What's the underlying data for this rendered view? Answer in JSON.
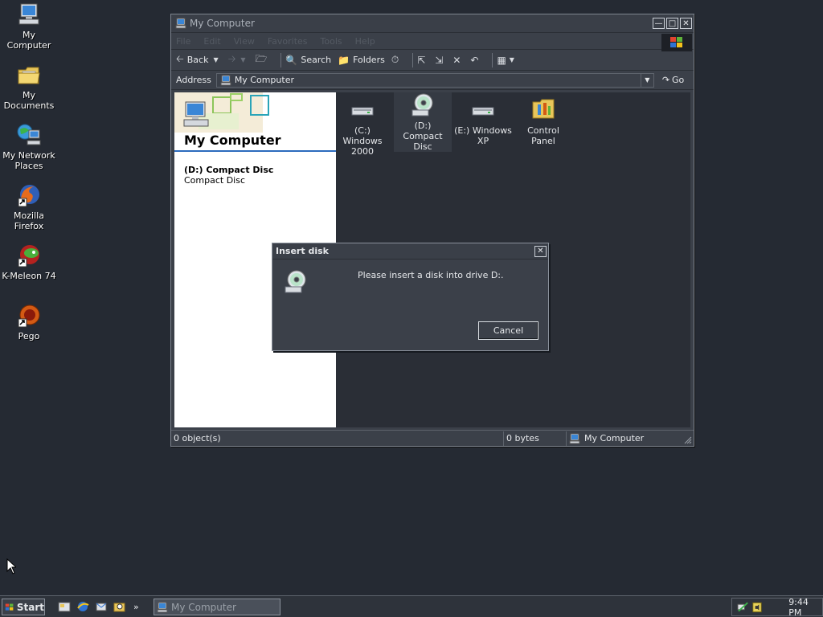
{
  "desktop": {
    "icons": [
      {
        "label": "My Computer",
        "icon": "my-computer-icon"
      },
      {
        "label": "My Documents",
        "icon": "folder-icon"
      },
      {
        "label": "My Network Places",
        "icon": "network-icon"
      },
      {
        "label": "Mozilla Firefox",
        "icon": "firefox-icon"
      },
      {
        "label": "K-Meleon 74",
        "icon": "k-meleon-icon"
      },
      {
        "label": "Pego",
        "icon": "pego-icon"
      }
    ]
  },
  "window": {
    "title": "My Computer",
    "menu": [
      "File",
      "Edit",
      "View",
      "Favorites",
      "Tools",
      "Help"
    ],
    "toolbar": {
      "back": "Back",
      "search": "Search",
      "folders": "Folders"
    },
    "address": {
      "label": "Address",
      "value": "My Computer",
      "go": "Go"
    },
    "left_pane": {
      "title": "My Computer",
      "drive_name": "(D:) Compact Disc",
      "drive_type": "Compact Disc"
    },
    "items": [
      {
        "label": "(C:) Windows 2000",
        "icon": "hard-drive-icon"
      },
      {
        "label": "(D:) Compact Disc",
        "icon": "cd-drive-icon"
      },
      {
        "label": "(E:) Windows XP",
        "icon": "hard-drive-icon"
      },
      {
        "label": "Control Panel",
        "icon": "control-panel-icon"
      }
    ],
    "status": {
      "objects": "0 object(s)",
      "size": "0 bytes",
      "location": "My Computer"
    }
  },
  "dialog": {
    "title": "Insert disk",
    "message": "Please insert a disk into drive D:.",
    "cancel": "Cancel"
  },
  "taskbar": {
    "start": "Start",
    "task": "My Computer",
    "clock": "9:44 PM",
    "quick_more": "»"
  },
  "colors": {
    "desktop": "#252a33",
    "window": "#3b4049",
    "left_pane": "#ffffff",
    "accent": "#2c6bbd"
  }
}
